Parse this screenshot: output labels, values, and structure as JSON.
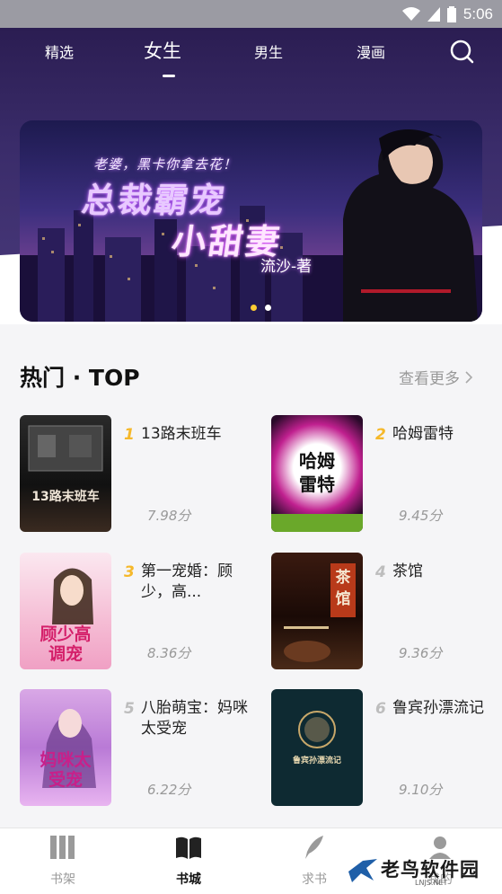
{
  "status_bar": {
    "time": "5:06"
  },
  "top_tabs": [
    {
      "label": "精选"
    },
    {
      "label": "女生"
    },
    {
      "label": "男生"
    },
    {
      "label": "漫画"
    }
  ],
  "banner": {
    "tagline": "老婆，黑卡你拿去花！",
    "title_line1": "总裁霸宠",
    "title_line2": "小甜妻",
    "author": "流沙-著",
    "active_dot": 0
  },
  "section": {
    "title": "热门 · TOP",
    "see_more": "查看更多"
  },
  "books": [
    {
      "rank": "1",
      "title": "13路末班车",
      "score": "7.98分",
      "cover_text": "13路末班车"
    },
    {
      "rank": "2",
      "title": "哈姆雷特",
      "score": "9.45分",
      "cover_text": "哈姆雷特"
    },
    {
      "rank": "3",
      "title": "第一宠婚：顾少，高...",
      "score": "8.36分",
      "cover_text": "顾少高调宠"
    },
    {
      "rank": "4",
      "title": "茶馆",
      "score": "9.36分",
      "cover_text": "茶馆"
    },
    {
      "rank": "5",
      "title": "八胎萌宝：妈咪太受宠",
      "score": "6.22分",
      "cover_text": "妈咪太受宠"
    },
    {
      "rank": "6",
      "title": "鲁宾孙漂流记",
      "score": "9.10分",
      "cover_text": "鲁宾孙漂流记"
    }
  ],
  "bottom_nav": [
    {
      "label": "书架"
    },
    {
      "label": "书城"
    },
    {
      "label": "求书"
    },
    {
      "label": "我的"
    }
  ],
  "watermark": {
    "text": "老鸟软件园",
    "sub": "LNJS.NET"
  },
  "colors": {
    "rank_gold": "#f5b82a",
    "rank_gray": "#bdbdbd",
    "accent_dot": "#ffcc33"
  }
}
